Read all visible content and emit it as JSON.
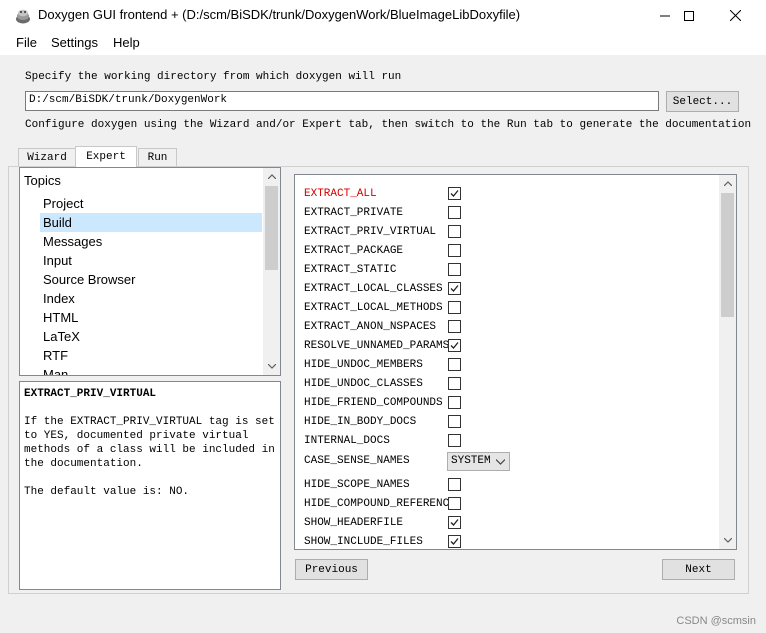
{
  "window": {
    "title": "Doxygen GUI frontend + (D:/scm/BiSDK/trunk/DoxygenWork/BlueImageLibDoxyfile)"
  },
  "menu": [
    "File",
    "Settings",
    "Help"
  ],
  "workdir": {
    "prompt": "Specify the working directory from which doxygen will run",
    "value": "D:/scm/BiSDK/trunk/DoxygenWork",
    "select_label": "Select...",
    "hint": "Configure doxygen using the Wizard and/or Expert tab, then switch to the Run tab to generate the documentation"
  },
  "tabs": [
    "Wizard",
    "Expert",
    "Run"
  ],
  "active_tab": "Expert",
  "topics": {
    "header": "Topics",
    "items": [
      "Project",
      "Build",
      "Messages",
      "Input",
      "Source Browser",
      "Index",
      "HTML",
      "LaTeX",
      "RTF",
      "Man"
    ],
    "selected": "Build"
  },
  "help": {
    "title": "EXTRACT_PRIV_VIRTUAL",
    "body": "If the EXTRACT_PRIV_VIRTUAL tag is set to YES, documented private virtual methods of a class will be included in the documentation.",
    "default": "The default value is: NO."
  },
  "options": [
    {
      "name": "EXTRACT_ALL",
      "type": "bool",
      "checked": true,
      "highlight": true
    },
    {
      "name": "EXTRACT_PRIVATE",
      "type": "bool",
      "checked": false
    },
    {
      "name": "EXTRACT_PRIV_VIRTUAL",
      "type": "bool",
      "checked": false
    },
    {
      "name": "EXTRACT_PACKAGE",
      "type": "bool",
      "checked": false
    },
    {
      "name": "EXTRACT_STATIC",
      "type": "bool",
      "checked": false
    },
    {
      "name": "EXTRACT_LOCAL_CLASSES",
      "type": "bool",
      "checked": true
    },
    {
      "name": "EXTRACT_LOCAL_METHODS",
      "type": "bool",
      "checked": false
    },
    {
      "name": "EXTRACT_ANON_NSPACES",
      "type": "bool",
      "checked": false
    },
    {
      "name": "RESOLVE_UNNAMED_PARAMS",
      "type": "bool",
      "checked": true
    },
    {
      "name": "HIDE_UNDOC_MEMBERS",
      "type": "bool",
      "checked": false
    },
    {
      "name": "HIDE_UNDOC_CLASSES",
      "type": "bool",
      "checked": false
    },
    {
      "name": "HIDE_FRIEND_COMPOUNDS",
      "type": "bool",
      "checked": false
    },
    {
      "name": "HIDE_IN_BODY_DOCS",
      "type": "bool",
      "checked": false
    },
    {
      "name": "INTERNAL_DOCS",
      "type": "bool",
      "checked": false
    },
    {
      "name": "CASE_SENSE_NAMES",
      "type": "enum",
      "value": "SYSTEM"
    },
    {
      "name": "HIDE_SCOPE_NAMES",
      "type": "bool",
      "checked": false
    },
    {
      "name": "HIDE_COMPOUND_REFERENCE",
      "type": "bool",
      "checked": false
    },
    {
      "name": "SHOW_HEADERFILE",
      "type": "bool",
      "checked": true
    },
    {
      "name": "SHOW_INCLUDE_FILES",
      "type": "bool",
      "checked": true
    }
  ],
  "nav": {
    "previous": "Previous",
    "next": "Next"
  },
  "watermark": "CSDN @scmsin",
  "colors": {
    "highlight_option": "#d60000",
    "selection": "#cce8ff"
  }
}
